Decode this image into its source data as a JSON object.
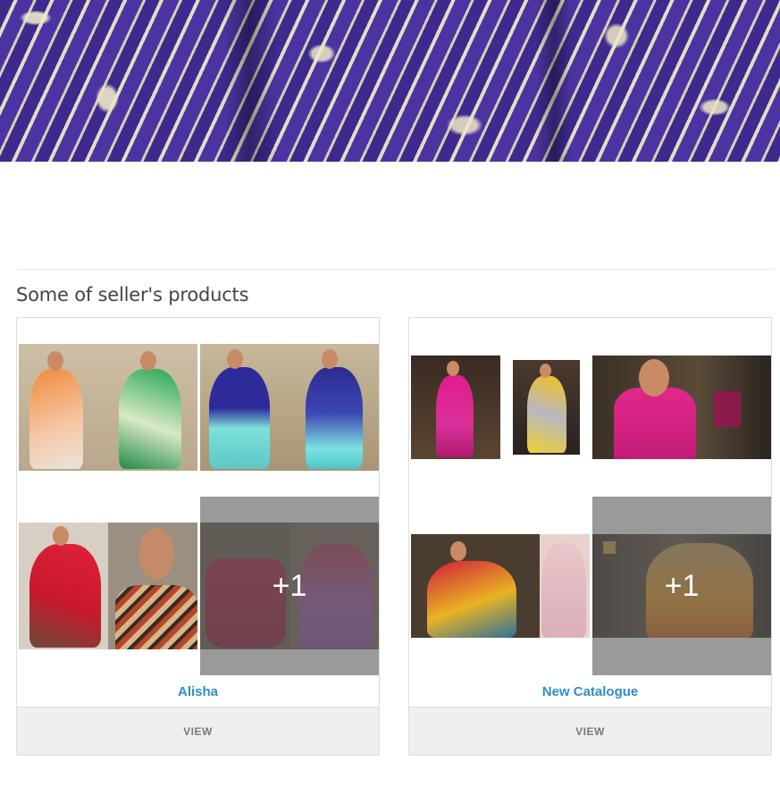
{
  "section": {
    "title": "Some of seller's products"
  },
  "catalogs": [
    {
      "name": "Alisha",
      "view_label": "VIEW",
      "more_count": "+1"
    },
    {
      "name": "New Catalogue",
      "view_label": "VIEW",
      "more_count": "+1"
    }
  ],
  "colors": {
    "link": "#2c8fcd",
    "button_bg": "#efefef",
    "banner": "#3f2d93"
  }
}
